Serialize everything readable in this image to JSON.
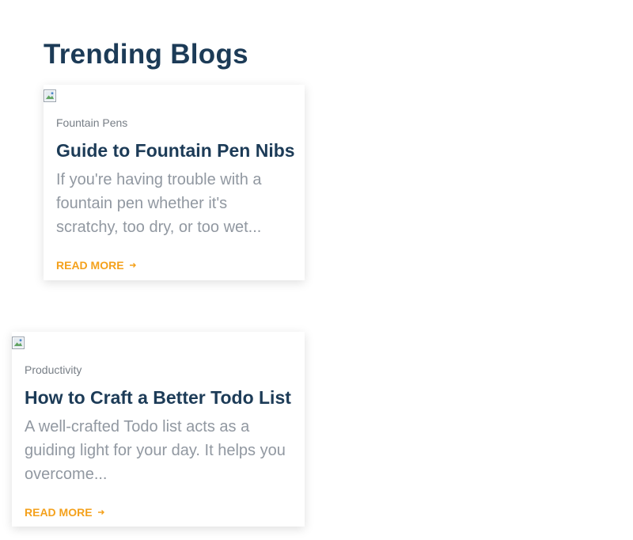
{
  "section": {
    "title": "Trending Blogs"
  },
  "posts": [
    {
      "category": "Fountain Pens",
      "title": "Guide to Fountain Pen Nibs",
      "excerpt": "If you're having trouble with a fountain pen whether it's scratchy, too dry, or too wet...",
      "read_more": "READ MORE"
    },
    {
      "category": "Productivity",
      "title": "How to Craft a Better Todo List",
      "excerpt": "A well-crafted Todo list acts as a guiding light for your day. It helps you overcome...",
      "read_more": "READ MORE"
    }
  ],
  "colors": {
    "heading": "#1c3b57",
    "accent": "#f4a11c",
    "muted": "#9198a1",
    "category": "#777e86"
  },
  "icons": {
    "broken_image": "broken-image-icon",
    "read_more_arrow": "arrow-right-icon"
  }
}
